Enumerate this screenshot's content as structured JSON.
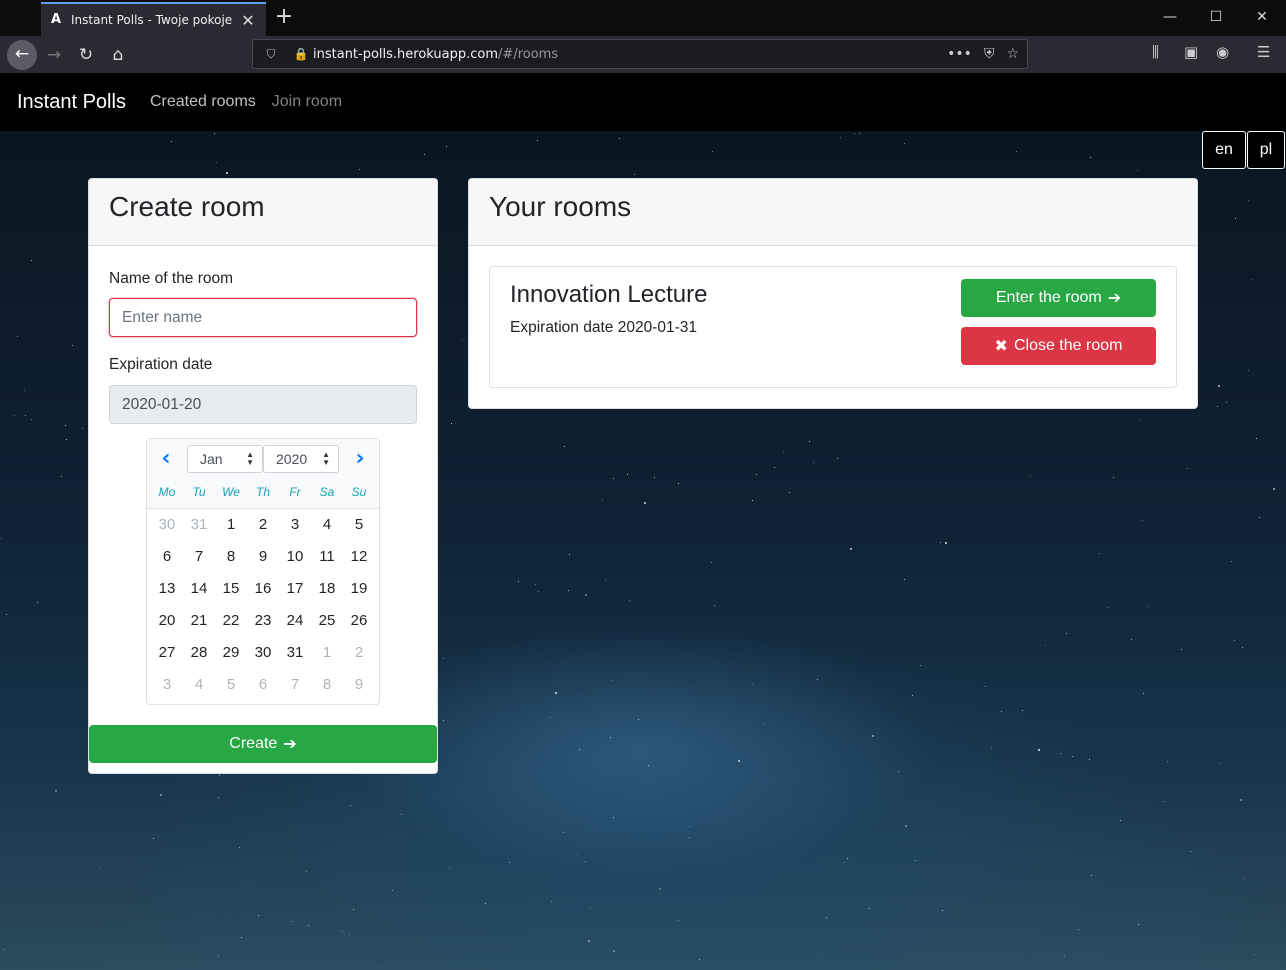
{
  "browser": {
    "tab_title": "Instant Polls - Twoje pokoje",
    "url_host": "instant-polls.herokuapp.com",
    "url_path": "/#/rooms"
  },
  "nav": {
    "brand": "Instant Polls",
    "links": [
      "Created rooms",
      "Join room"
    ]
  },
  "languages": [
    "en",
    "pl"
  ],
  "create_room": {
    "title": "Create room",
    "name_label": "Name of the room",
    "name_placeholder": "Enter name",
    "expiration_label": "Expiration date",
    "expiration_value": "2020-01-20",
    "create_label": "Create"
  },
  "datepicker": {
    "month": "Jan",
    "year": "2020",
    "weekdays": [
      "Mo",
      "Tu",
      "We",
      "Th",
      "Fr",
      "Sa",
      "Su"
    ],
    "weeks": [
      [
        {
          "d": "30",
          "out": true
        },
        {
          "d": "31",
          "out": true
        },
        {
          "d": "1"
        },
        {
          "d": "2"
        },
        {
          "d": "3"
        },
        {
          "d": "4"
        },
        {
          "d": "5"
        }
      ],
      [
        {
          "d": "6"
        },
        {
          "d": "7"
        },
        {
          "d": "8"
        },
        {
          "d": "9"
        },
        {
          "d": "10"
        },
        {
          "d": "11"
        },
        {
          "d": "12"
        }
      ],
      [
        {
          "d": "13"
        },
        {
          "d": "14"
        },
        {
          "d": "15"
        },
        {
          "d": "16"
        },
        {
          "d": "17"
        },
        {
          "d": "18"
        },
        {
          "d": "19"
        }
      ],
      [
        {
          "d": "20"
        },
        {
          "d": "21"
        },
        {
          "d": "22"
        },
        {
          "d": "23"
        },
        {
          "d": "24"
        },
        {
          "d": "25"
        },
        {
          "d": "26"
        }
      ],
      [
        {
          "d": "27"
        },
        {
          "d": "28"
        },
        {
          "d": "29"
        },
        {
          "d": "30"
        },
        {
          "d": "31"
        },
        {
          "d": "1",
          "out": true
        },
        {
          "d": "2",
          "out": true
        }
      ],
      [
        {
          "d": "3",
          "out": true
        },
        {
          "d": "4",
          "out": true
        },
        {
          "d": "5",
          "out": true
        },
        {
          "d": "6",
          "out": true
        },
        {
          "d": "7",
          "out": true
        },
        {
          "d": "8",
          "out": true
        },
        {
          "d": "9",
          "out": true
        }
      ]
    ]
  },
  "your_rooms": {
    "title": "Your rooms",
    "rooms": [
      {
        "name": "Innovation Lecture",
        "expiration": "Expiration date 2020-01-31",
        "enter_label": "Enter the room",
        "close_label": "Close the room"
      }
    ]
  },
  "colors": {
    "success": "#28a745",
    "danger": "#dc3545",
    "primary": "#007bff",
    "weekday": "#17a2b8"
  }
}
